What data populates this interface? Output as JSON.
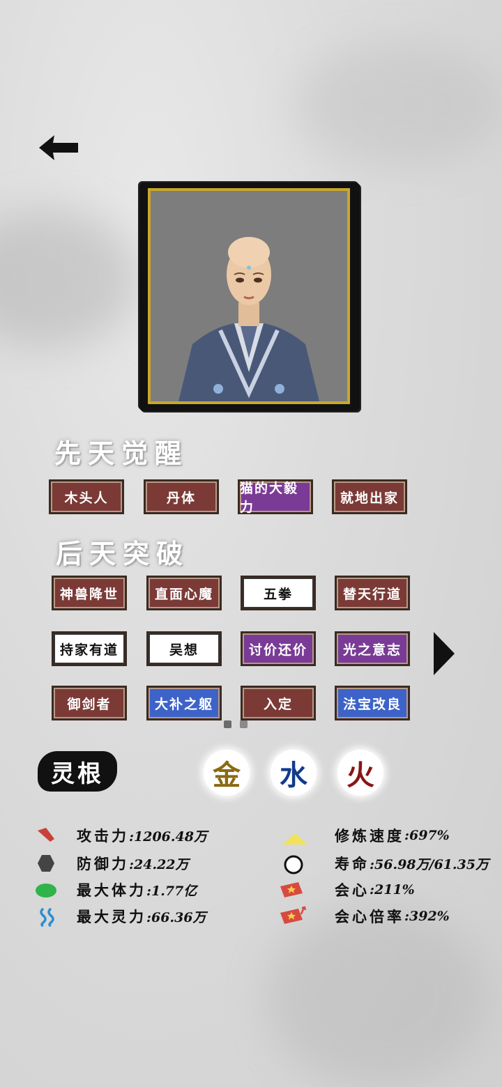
{
  "innate": {
    "title": "先天觉醒",
    "tags": [
      {
        "label": "木头人",
        "color": "red"
      },
      {
        "label": "丹体",
        "color": "red"
      },
      {
        "label": "猫的大毅力",
        "color": "purple"
      },
      {
        "label": "就地出家",
        "color": "red"
      }
    ]
  },
  "acquired": {
    "title": "后天突破",
    "tags": [
      {
        "label": "神兽降世",
        "color": "red"
      },
      {
        "label": "直面心魔",
        "color": "red"
      },
      {
        "label": "五拳",
        "color": "white"
      },
      {
        "label": "替天行道",
        "color": "red"
      },
      {
        "label": "持家有道",
        "color": "white"
      },
      {
        "label": "吴想",
        "color": "white"
      },
      {
        "label": "讨价还价",
        "color": "purple"
      },
      {
        "label": "光之意志",
        "color": "purple"
      },
      {
        "label": "御剑者",
        "color": "red"
      },
      {
        "label": "大补之躯",
        "color": "blue"
      },
      {
        "label": "入定",
        "color": "red"
      },
      {
        "label": "法宝改良",
        "color": "blue"
      }
    ]
  },
  "spirit_root": {
    "label": "灵根",
    "elements": [
      {
        "char": "金",
        "color": "#8a6a12"
      },
      {
        "char": "水",
        "color": "#123a8a"
      },
      {
        "char": "火",
        "color": "#8a1414"
      }
    ]
  },
  "stats": {
    "attack": {
      "label": "攻击力",
      "value": ":1206.48万",
      "icon": "attack-icon"
    },
    "defense": {
      "label": "防御力",
      "value": ":24.22万",
      "icon": "defense-icon"
    },
    "max_hp": {
      "label": "最大体力",
      "value": ":1.77亿",
      "icon": "hp-icon"
    },
    "max_mp": {
      "label": "最大灵力",
      "value": ":66.36万",
      "icon": "mp-icon"
    },
    "cultivation_speed": {
      "label": "修炼速度",
      "value": ":697%",
      "icon": "cultivation-icon"
    },
    "lifespan": {
      "label": "寿命",
      "value": ":56.98万/61.35万",
      "icon": "lifespan-icon"
    },
    "crit": {
      "label": "会心",
      "value": ":211%",
      "icon": "crit-icon"
    },
    "crit_multiplier": {
      "label": "会心倍率",
      "value": ":392%",
      "icon": "crit-multiplier-icon"
    }
  }
}
